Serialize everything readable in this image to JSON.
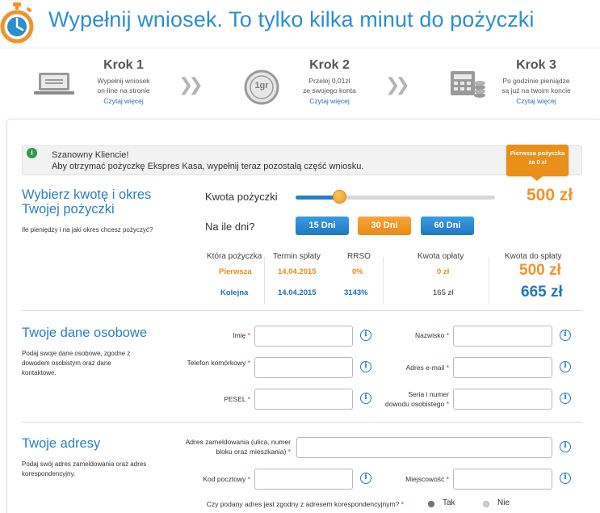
{
  "header": {
    "title": "Wypełnij wniosek. To tylko kilka minut do pożyczki",
    "icon": "stopwatch-icon",
    "accent": "#2b8fd0"
  },
  "steps": [
    {
      "title": "Krok 1",
      "desc1": "Wypełnij wniosek",
      "desc2": "on-line na stronie",
      "link": "Czytaj więcej",
      "icon": "laptop-icon"
    },
    {
      "title": "Krok 2",
      "desc1": "Przelej 0,01zł",
      "desc2": "ze swojego konta",
      "link": "Czytaj więcej",
      "icon": "coin-icon",
      "coin_label": "1gr"
    },
    {
      "title": "Krok 3",
      "desc1": "Po godzinie pieniądze",
      "desc2": "są już na twoim koncie",
      "link": "Czytaj więcej",
      "icon": "cash-register-icon"
    }
  ],
  "notice": {
    "line1": "Szanowny Kliencie!",
    "line2": "Aby otrzymać pożyczkę Ekspres Kasa, wypełnij teraz pozostałą część wniosku."
  },
  "promo": {
    "line1": "Pierwsza pożyczka",
    "line2": "za 0 zł"
  },
  "loan": {
    "title1": "Wybierz kwotę i okres",
    "title2": "Twojej pożyczki",
    "desc": "Ile pieniędzy i na jaki okres chcesz pożyczyć?",
    "amount_label": "Kwota pożyczki",
    "amount_value": "500 zł",
    "slider_level": 0.22,
    "days_label": "Na ile dni?",
    "day_options": [
      "15 Dni",
      "30 Dni",
      "60 Dni"
    ],
    "selected_day": "30 Dni"
  },
  "summary": {
    "headers": [
      "Która pożyczka",
      "Termin spłaty",
      "RRSO",
      "Kwota opłaty",
      "Kwota do spłaty"
    ],
    "rows": [
      {
        "which": "Pierwsza",
        "date": "14.04.2015",
        "rrso": "0%",
        "fee": "0 zł",
        "total": "500 zł"
      },
      {
        "which": "Kolejna",
        "date": "14.04.2015",
        "rrso": "3143%",
        "fee": "165 zł",
        "total": "665 zł"
      }
    ]
  },
  "personal": {
    "title": "Twoje dane osobowe",
    "desc1": "Podaj swoje dane osobowe, zgodne z",
    "desc2": "dowodem osobistym oraz dane",
    "desc3": "kontaktowe.",
    "labels": {
      "first_name": "Imię",
      "last_name": "Nazwisko",
      "phone": "Telefon komórkowy",
      "email": "Adres e-mail",
      "pesel": "PESEL",
      "id1": "Seria i numer",
      "id2": "dowodu osobistego"
    }
  },
  "address": {
    "title": "Twoje adresy",
    "desc1": "Podaj swój adres zameldowania oraz adres",
    "desc2": "korespondencyjny.",
    "labels": {
      "addr1": "Adres zameldowania (ulica, numer",
      "addr2": "bloku oraz mieszkania)",
      "postal": "Kod pocztowy",
      "city": "Miejscowość",
      "same": "Czy podany adres jest zgodny z adresem korespondencyjnym?"
    },
    "radio_yes": "Tak",
    "radio_no": "Nie",
    "selected": "Tak"
  },
  "required_mark": "*",
  "info_glyph": "i",
  "colors": {
    "blue": "#2b7fc1",
    "orange": "#f0932b",
    "required": "#d3262b"
  }
}
